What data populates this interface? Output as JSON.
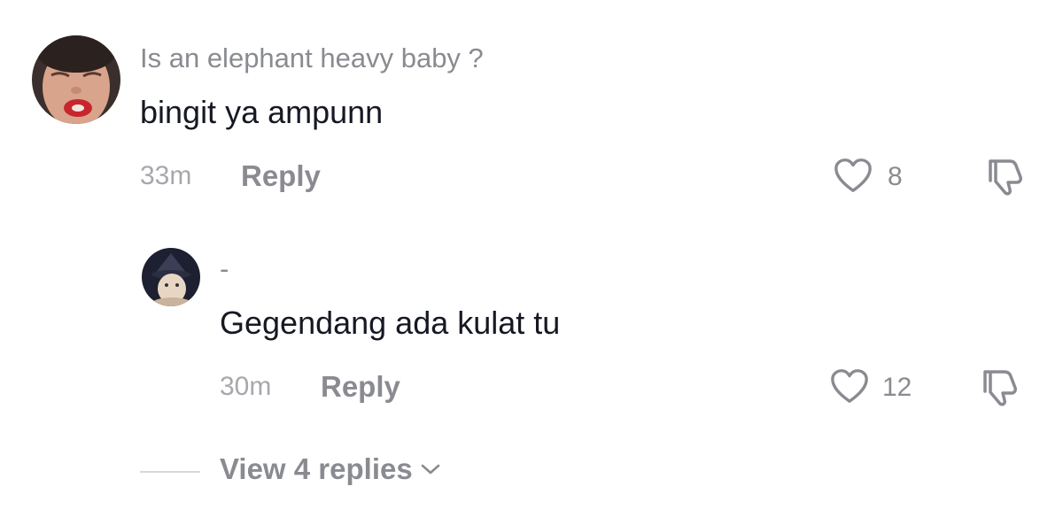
{
  "comment": {
    "username": "Is an elephant heavy baby ?",
    "text": "bingit ya ampunn",
    "time": "33m",
    "reply_label": "Reply",
    "like_count": "8",
    "like_icon": "heart-outline-icon",
    "dislike_icon": "thumbs-down-icon"
  },
  "reply": {
    "username": "-",
    "text": "Gegendang ada kulat tu",
    "time": "30m",
    "reply_label": "Reply",
    "like_count": "12",
    "like_icon": "heart-outline-icon",
    "dislike_icon": "thumbs-down-icon"
  },
  "view_replies": {
    "label": "View 4 replies",
    "icon": "chevron-down-icon"
  },
  "colors": {
    "username": "#8a8b91",
    "text": "#161823",
    "muted": "#a7a8ad"
  }
}
